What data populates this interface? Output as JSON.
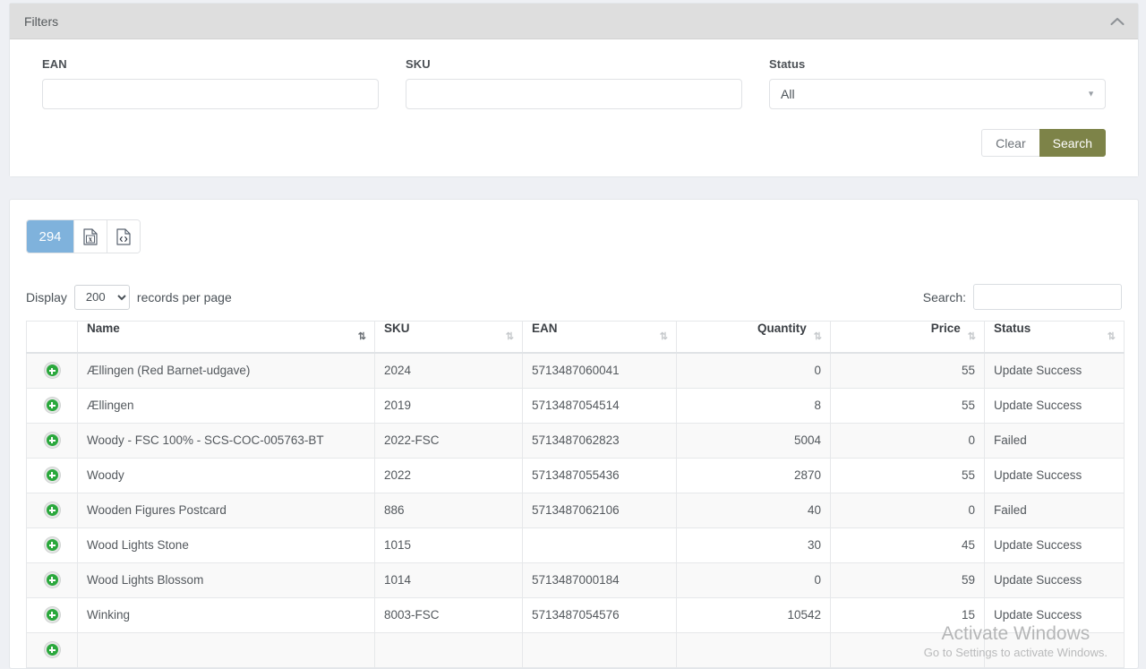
{
  "filters": {
    "title": "Filters",
    "collapse_icon": "chevron-up-icon",
    "fields": {
      "ean_label": "EAN",
      "ean_value": "",
      "ean_placeholder": "",
      "sku_label": "SKU",
      "sku_value": "",
      "sku_placeholder": "",
      "status_label": "Status",
      "status_value": "All",
      "status_options": [
        "All"
      ]
    },
    "clear_label": "Clear",
    "search_label": "Search",
    "search_button_color": "#7d8348"
  },
  "toolbar": {
    "count": "294",
    "count_badge_color": "#7fb2dc",
    "excel_export_icon": "file-excel-icon",
    "xml_export_icon": "file-code-icon"
  },
  "table_controls": {
    "display_label": "Display",
    "records_value": "200",
    "records_options": [
      "200"
    ],
    "records_suffix": "records per page",
    "search_label": "Search:",
    "search_value": "",
    "search_placeholder": ""
  },
  "table": {
    "columns": [
      {
        "key": "expand",
        "label": "",
        "align": "left",
        "sort": "none"
      },
      {
        "key": "name",
        "label": "Name",
        "align": "left",
        "sort": "desc"
      },
      {
        "key": "sku",
        "label": "SKU",
        "align": "left",
        "sort": "both"
      },
      {
        "key": "ean",
        "label": "EAN",
        "align": "left",
        "sort": "both"
      },
      {
        "key": "quantity",
        "label": "Quantity",
        "align": "right",
        "sort": "both"
      },
      {
        "key": "price",
        "label": "Price",
        "align": "right",
        "sort": "both"
      },
      {
        "key": "status",
        "label": "Status",
        "align": "left",
        "sort": "both"
      }
    ],
    "rows": [
      {
        "expand_icon": "plus-circle-icon",
        "name": "Ællingen (Red Barnet-udgave)",
        "sku": "2024",
        "ean": "5713487060041",
        "quantity": "0",
        "price": "55",
        "status": "Update Success"
      },
      {
        "expand_icon": "plus-circle-icon",
        "name": "Ællingen",
        "sku": "2019",
        "ean": "5713487054514",
        "quantity": "8",
        "price": "55",
        "status": "Update Success"
      },
      {
        "expand_icon": "plus-circle-icon",
        "name": "Woody - FSC 100% - SCS-COC-005763-BT",
        "sku": "2022-FSC",
        "ean": "5713487062823",
        "quantity": "5004",
        "price": "0",
        "status": "Failed"
      },
      {
        "expand_icon": "plus-circle-icon",
        "name": "Woody",
        "sku": "2022",
        "ean": "5713487055436",
        "quantity": "2870",
        "price": "55",
        "status": "Update Success"
      },
      {
        "expand_icon": "plus-circle-icon",
        "name": "Wooden Figures Postcard",
        "sku": "886",
        "ean": "5713487062106",
        "quantity": "40",
        "price": "0",
        "status": "Failed"
      },
      {
        "expand_icon": "plus-circle-icon",
        "name": "Wood Lights Stone",
        "sku": "1015",
        "ean": "",
        "quantity": "30",
        "price": "45",
        "status": "Update Success"
      },
      {
        "expand_icon": "plus-circle-icon",
        "name": "Wood Lights Blossom",
        "sku": "1014",
        "ean": "5713487000184",
        "quantity": "0",
        "price": "59",
        "status": "Update Success"
      },
      {
        "expand_icon": "plus-circle-icon",
        "name": "Winking",
        "sku": "8003-FSC",
        "ean": "5713487054576",
        "quantity": "10542",
        "price": "15",
        "status": "Update Success"
      },
      {
        "expand_icon": "plus-circle-icon",
        "name": "",
        "sku": "",
        "ean": "",
        "quantity": "",
        "price": "",
        "status": ""
      }
    ]
  },
  "watermark": {
    "title": "Activate Windows",
    "subtitle": "Go to Settings to activate Windows."
  }
}
